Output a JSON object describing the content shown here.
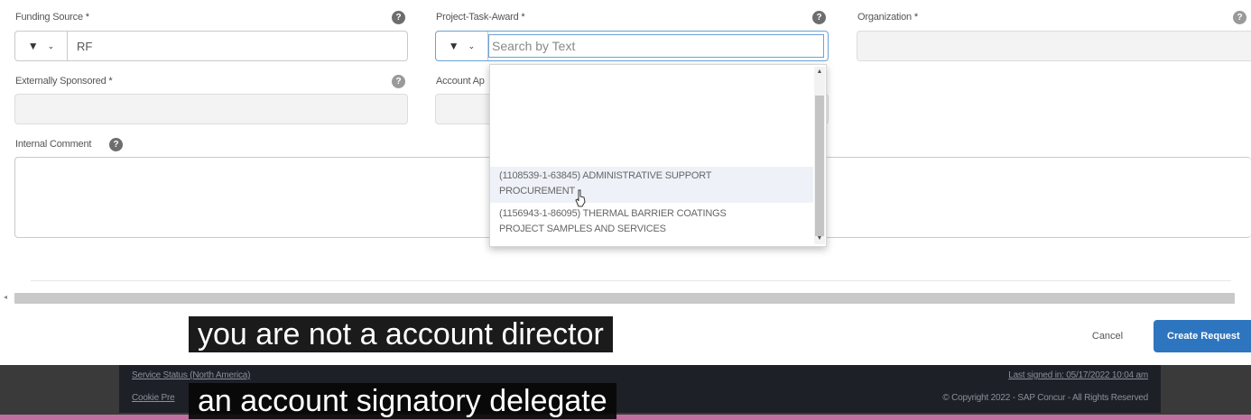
{
  "form": {
    "funding_source": {
      "label": "Funding Source",
      "required": "*",
      "help": "?",
      "value": "RF",
      "filter_icon": "filter-icon",
      "chevron_icon": "chevron-down-icon"
    },
    "project_task_award": {
      "label": "Project-Task-Award",
      "required": "*",
      "help": "?",
      "placeholder": "Search by Text",
      "value": "",
      "filter_icon": "filter-icon"
    },
    "organization": {
      "label": "Organization",
      "required": "*",
      "help": "?",
      "value": ""
    },
    "externally_sponsored": {
      "label": "Externally Sponsored",
      "required": "*",
      "help": "?",
      "value": ""
    },
    "account_approver": {
      "label": "Account Ap",
      "value": ""
    },
    "internal_comment": {
      "label": "Internal Comment",
      "help": "?",
      "value": ""
    }
  },
  "dropdown": {
    "options": [
      {
        "line1": "(1108539-1-63845) ADMINISTRATIVE SUPPORT",
        "line2": "PROCUREMENT"
      },
      {
        "line1": "(1156943-1-86095) THERMAL BARRIER COATINGS",
        "line2": "PROJECT SAMPLES AND SERVICES"
      }
    ]
  },
  "actions": {
    "cancel": "Cancel",
    "create": "Create Request"
  },
  "footer": {
    "service_status": "Service Status (North America)",
    "cookie": "Cookie Pre",
    "last_signed_in": "Last signed in: 05/17/2022 10:04 am",
    "copyright": "© Copyright 2022 - SAP Concur - All Rights Reserved"
  },
  "captions": {
    "line1": "you are not a account director",
    "line2": "an account signatory delegate"
  },
  "colors": {
    "primary_button": "#2e75bf",
    "focus_border": "#6aa2d8",
    "footer": "#1d2026"
  }
}
